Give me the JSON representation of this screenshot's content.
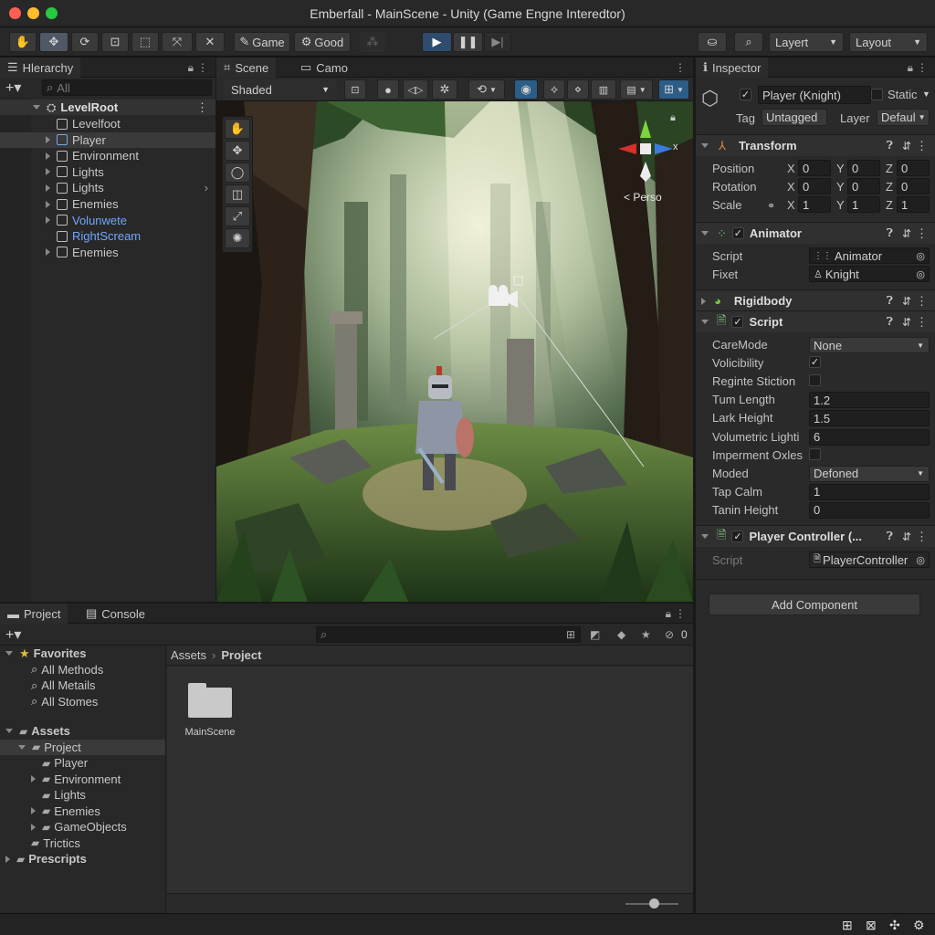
{
  "window": {
    "title": "Emberfall - MainScene - Unity (Game Engne Interedtor)"
  },
  "toolbar": {
    "tools": [
      "hand-tool",
      "move-tool",
      "rotate-tool",
      "scale-tool",
      "rect-tool",
      "transform-tool",
      "custom-tool"
    ],
    "game_label": "Game",
    "good_label": "Good",
    "layers_label": "Layert",
    "layout_label": "Layout"
  },
  "hierarchy": {
    "tab": "Hlerarchy",
    "search_placeholder": "All",
    "root": "LevelRoot",
    "items": [
      {
        "label": "Levelfoot",
        "indent": 1,
        "arrow": false
      },
      {
        "label": "Player",
        "indent": 1,
        "arrow": true
      },
      {
        "label": "Environment",
        "indent": 1,
        "arrow": true
      },
      {
        "label": "Lights",
        "indent": 1,
        "arrow": true
      },
      {
        "label": "Lights",
        "indent": 1,
        "arrow": true
      },
      {
        "label": "Enemies",
        "indent": 1,
        "arrow": true
      },
      {
        "label": "Volunwete",
        "indent": 1,
        "arrow": true
      },
      {
        "label": "RightScream",
        "indent": 1,
        "arrow": false
      },
      {
        "label": "Enemies",
        "indent": 1,
        "arrow": true
      }
    ]
  },
  "scene": {
    "tab_scene": "Scene",
    "tab_camo": "Camo",
    "shading": "Shaded",
    "gizmo_label": "< Perso",
    "gizmo_axis": "x"
  },
  "inspector": {
    "tab": "Inspector",
    "object_name": "Player (Knight)",
    "static_label": "Static",
    "tag_label": "Tag",
    "tag_value": "Untagged",
    "layer_label": "Layer",
    "layer_value": "Defaul",
    "transform": {
      "title": "Transform",
      "rows": [
        {
          "label": "Position",
          "x": "0",
          "y": "0",
          "z": "0"
        },
        {
          "label": "Rotation",
          "x": "0",
          "y": "0",
          "z": "0"
        },
        {
          "label": "Scale",
          "x": "1",
          "y": "1",
          "z": "1"
        }
      ],
      "axis_x": "X",
      "axis_y": "Y",
      "axis_z": "Z"
    },
    "animator": {
      "title": "Animator",
      "script_label": "Script",
      "script_value": "Animator",
      "fixet_label": "Fixet",
      "fixet_value": "Knight"
    },
    "rigidbody": {
      "title": "Rigidbody"
    },
    "script": {
      "title": "Script",
      "fields": [
        {
          "label": "CareMode",
          "value": "None",
          "type": "dropdown"
        },
        {
          "label": "Volicibility",
          "value": "",
          "type": "checkbox",
          "checked": true
        },
        {
          "label": "Reginte Stiction",
          "value": "",
          "type": "checkbox",
          "checked": false
        },
        {
          "label": "Tum Length",
          "value": "1.2",
          "type": "text"
        },
        {
          "label": "Lark Height",
          "value": "1.5",
          "type": "text"
        },
        {
          "label": "Volumetric Lighti",
          "value": "6",
          "type": "text"
        },
        {
          "label": "Imperment Oxles",
          "value": "",
          "type": "checkbox",
          "checked": false
        },
        {
          "label": "Moded",
          "value": "Defoned",
          "type": "dropdown"
        },
        {
          "label": "Tap Calm",
          "value": "1",
          "type": "text"
        },
        {
          "label": "Tanin Height",
          "value": "0",
          "type": "text"
        }
      ]
    },
    "player_controller": {
      "title": "Player Controller (...",
      "script_label": "Script",
      "script_value": "PlayerController"
    },
    "add_component": "Add Component"
  },
  "project": {
    "tab_project": "Project",
    "tab_console": "Console",
    "count": "0",
    "favorites_label": "Favorites",
    "favorites": [
      "All Methods",
      "All Metails",
      "All Stomes"
    ],
    "assets_label": "Assets",
    "project_folder": "Project",
    "subfolders": [
      {
        "label": "Player",
        "arrow": false
      },
      {
        "label": "Environment",
        "arrow": true
      },
      {
        "label": "Lights",
        "arrow": false
      },
      {
        "label": "Enemies",
        "arrow": true
      },
      {
        "label": "GameObjects",
        "arrow": true
      }
    ],
    "tractics": "Trictics",
    "prescripts": "Prescripts",
    "breadcrumb_root": "Assets",
    "breadcrumb_current": "Project",
    "files": [
      {
        "name": "MainScene"
      }
    ]
  },
  "colors": {
    "accent": "#2c5d87",
    "selection": "#3e4a5a",
    "link": "#6fa8ff",
    "bg": "#282828"
  }
}
